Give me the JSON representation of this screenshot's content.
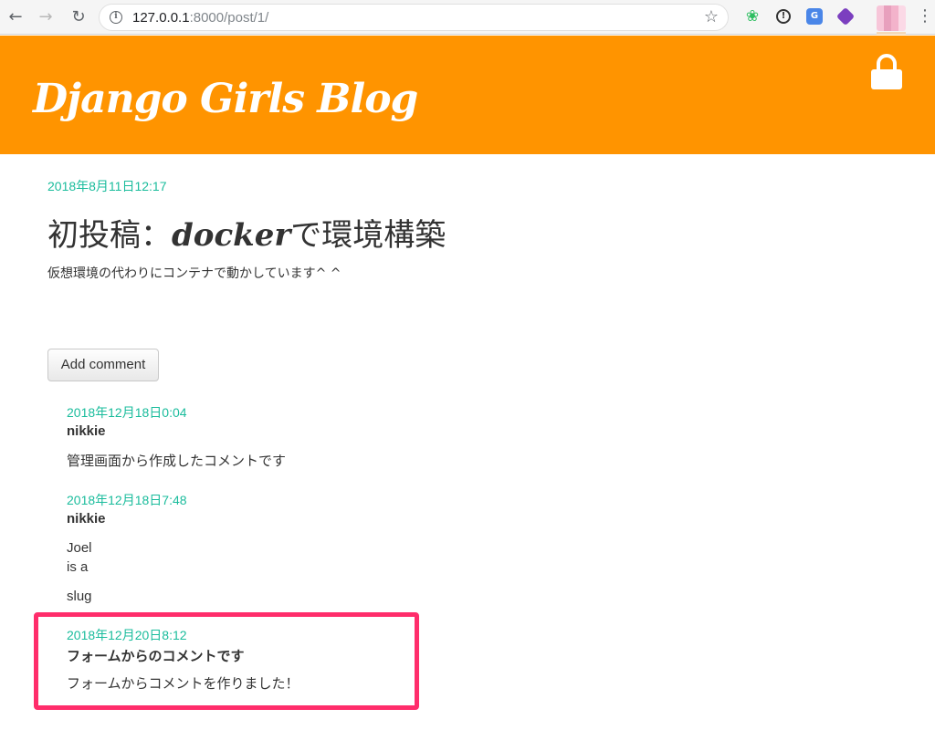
{
  "browser": {
    "url_host": "127.0.0.1",
    "url_rest": ":8000/post/1/",
    "back_icon": "←",
    "forward_icon": "→",
    "reload_icon": "↻",
    "star_icon": "☆",
    "menu_icon": "⋮"
  },
  "header": {
    "title": "Django Girls Blog"
  },
  "post": {
    "date": "2018年8月11日12:17",
    "title_prefix": "初投稿：",
    "title_em": "docker",
    "title_suffix": "で環境構築",
    "text": "仮想環境の代わりにコンテナで動かしています^ ^"
  },
  "actions": {
    "add_comment_label": "Add comment"
  },
  "comments": [
    {
      "date": "2018年12月18日0:04",
      "author": "nikkie",
      "lines": [
        "管理画面から作成したコメントです"
      ]
    },
    {
      "date": "2018年12月18日7:48",
      "author": "nikkie",
      "lines": [
        "Joel",
        "is a",
        "slug"
      ]
    },
    {
      "date": "2018年12月20日8:12",
      "author": "フォームからのコメントです",
      "lines": [
        "フォームからコメントを作りました！"
      ]
    }
  ],
  "colors": {
    "header_bg": "#ff9400",
    "date_text": "#1abc9c",
    "highlight_border": "#ff2d6b"
  }
}
